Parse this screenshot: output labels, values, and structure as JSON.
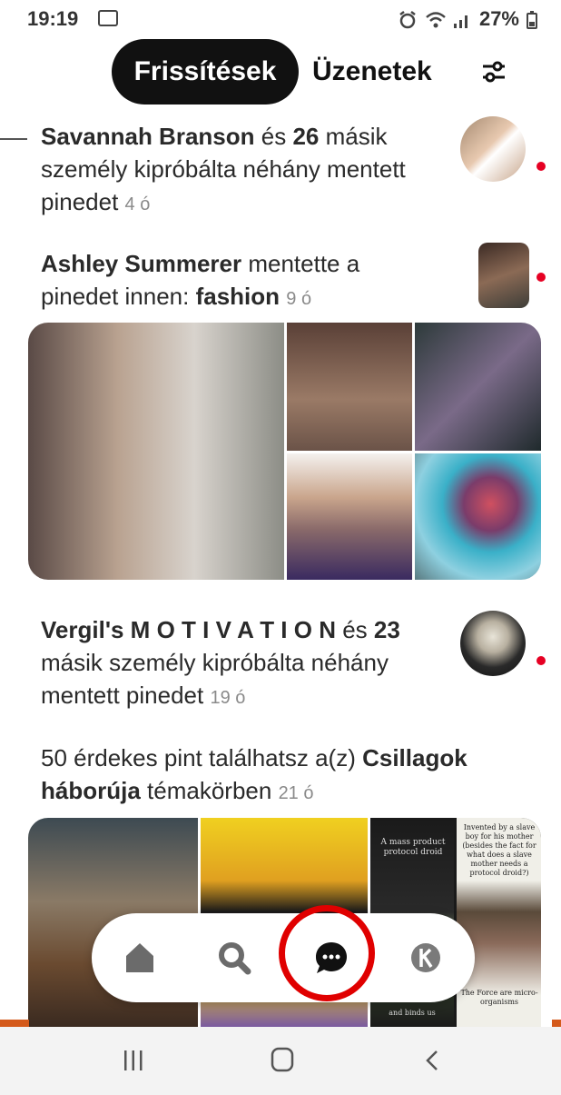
{
  "status_bar": {
    "time": "19:19",
    "battery": "27%"
  },
  "header": {
    "tab_active": "Frissítések",
    "tab_inactive": "Üzenetek"
  },
  "feed": [
    {
      "bold1": "Savannah Branson",
      "reg1": " és ",
      "bold2": "26",
      "reg2": " másik személy kipróbálta néhány mentett pinedet",
      "time": "4 ó"
    },
    {
      "bold1": "Ashley Summerer",
      "reg1": " mentette a pinedet innen: ",
      "bold2": "fashion",
      "time": "9 ó"
    },
    {
      "bold1": "Vergil's M O T I V A T I O N",
      "reg1": " és ",
      "bold2": "23",
      "reg2": " másik személy kipróbálta néhány mentett pinedet",
      "time": "19 ó"
    },
    {
      "reg1": "50 érdekes pint találhatsz a(z) ",
      "bold1": "Csillagok háborúja",
      "reg2": " témakörben",
      "time": "21 ó"
    }
  ],
  "mosaic_texts": {
    "a_mass": "A mass product protocol droid",
    "invented": "Invented by a slave boy for his mother (besides the fact for what does a slave mother needs a protocol droid?)",
    "force": "The Force are micro-organisms",
    "binds": "and binds us"
  },
  "colors": {
    "accent": "#e60023",
    "highlight": "#e00000",
    "orange": "#d45a1b"
  }
}
